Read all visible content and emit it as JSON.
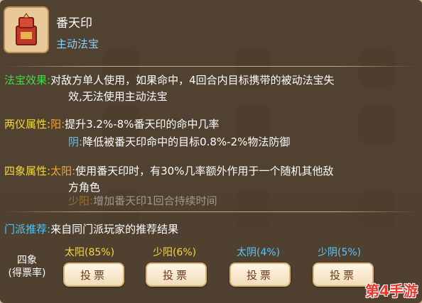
{
  "item": {
    "name": "番天印",
    "type": "主动法宝",
    "icon": "red-seal-box-icon"
  },
  "effect": {
    "label": "法宝效果:",
    "line1": "对敌方单人使用，如果命中，4回合内目标携带的被动法宝失",
    "line2": "效,无法使用主动法宝"
  },
  "liangyi": {
    "label": "两仪属性:",
    "yang_key": "阳:",
    "yang_text": "提升3.2%-8%番天印的命中几率",
    "yin_key": "阴:",
    "yin_text": "降低被番天印命中的目标0.8%-2%物法防御"
  },
  "sixiang": {
    "label": "四象属性:",
    "taiyang_key": "太阳:",
    "taiyang_line1": "使用番天印时，有30%几率额外作用于一个随机其他敌",
    "taiyang_line2": "方角色",
    "shaoyang_key": "少阳:",
    "shaoyang_text": "增加番天印1回合持续时间"
  },
  "recommend": {
    "label": "门派推荐:",
    "text": "来自同门派玩家的推荐结果"
  },
  "vote": {
    "heading_line1": "四象",
    "heading_line2": "(得票率)",
    "options": [
      {
        "label": "太阳(85%)",
        "button": "投票"
      },
      {
        "label": "少阳(6%)",
        "button": "投票"
      },
      {
        "label": "太阴(4%)",
        "button": "投票"
      },
      {
        "label": "少阴(5%)",
        "button": "投票"
      }
    ]
  },
  "watermark": "第4手游",
  "colors": {
    "green": "#3fdc4a",
    "yellow": "#f5d93a",
    "orange": "#f2a63a",
    "blue": "#57c7ff"
  }
}
